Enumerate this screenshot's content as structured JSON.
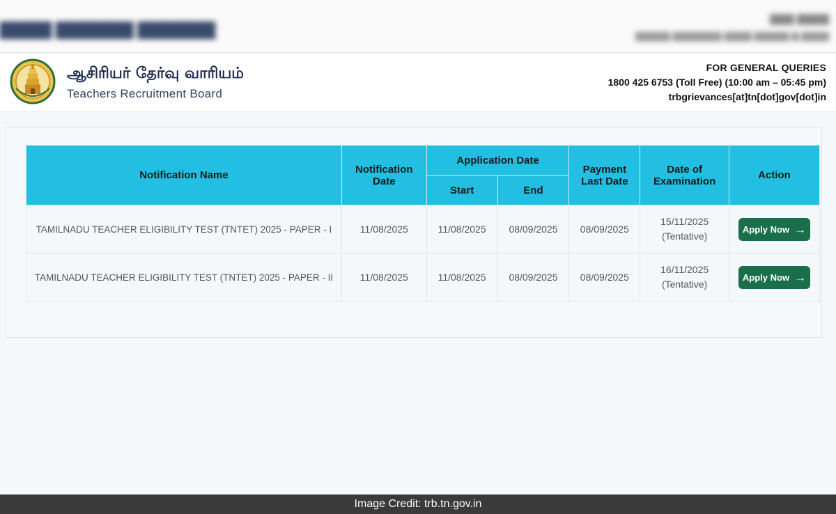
{
  "header": {
    "brand_tamil": "ஆசிரியர் தேர்வு வாரியம்",
    "brand_english": "Teachers Recruitment Board",
    "queries_title": "FOR GENERAL QUERIES",
    "queries_phone": "1800 425 6753 (Toll Free)  (10:00 am – 05:45 pm)",
    "queries_email": "trbgrievances[at]tn[dot]gov[dot]in",
    "emblem_icon": "tamil-nadu-emblem-icon"
  },
  "table": {
    "headers": {
      "notification_name": "Notification Name",
      "notification_date": "Notification Date",
      "application_date": "Application Date",
      "start": "Start",
      "end": "End",
      "payment_last_date": "Payment Last Date",
      "date_of_examination": "Date of Examination",
      "action": "Action"
    },
    "rows": [
      {
        "name": "TAMILNADU TEACHER ELIGIBILITY TEST (TNTET) 2025 - PAPER - I",
        "notification_date": "11/08/2025",
        "start": "11/08/2025",
        "end": "08/09/2025",
        "payment_last_date": "08/09/2025",
        "exam_date": "15/11/2025",
        "exam_note": "(Tentative)",
        "action_label": "Apply Now"
      },
      {
        "name": "TAMILNADU TEACHER ELIGIBILITY TEST (TNTET) 2025 - PAPER - II",
        "notification_date": "11/08/2025",
        "start": "11/08/2025",
        "end": "08/09/2025",
        "payment_last_date": "08/09/2025",
        "exam_date": "16/11/2025",
        "exam_note": "(Tentative)",
        "action_label": "Apply Now"
      }
    ]
  },
  "footer": {
    "credit": "Image Credit: trb.tn.gov.in"
  },
  "colors": {
    "table_header": "#22bfe3",
    "apply_button": "#1a6f4a",
    "footer_bg": "#3a3a3a"
  }
}
